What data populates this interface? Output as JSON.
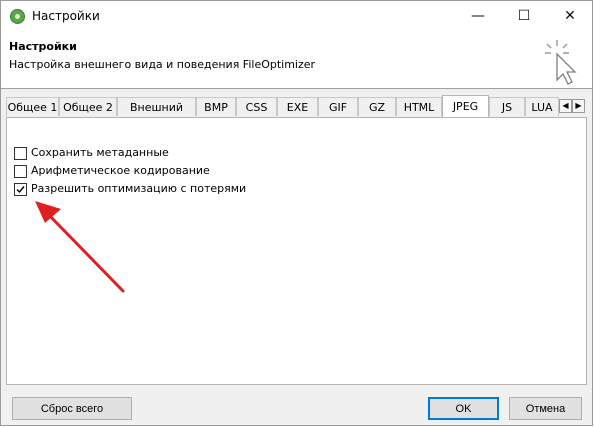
{
  "window": {
    "title": "Настройки",
    "minimize_glyph": "—",
    "maximize_glyph": "☐",
    "close_glyph": "✕"
  },
  "header": {
    "title": "Настройки",
    "subtitle": "Настройка внешнего вида и поведения FileOptimizer"
  },
  "tabs": [
    {
      "label": "Общее 1"
    },
    {
      "label": "Общее 2"
    },
    {
      "label": "Внешний вид"
    },
    {
      "label": "BMP"
    },
    {
      "label": "CSS"
    },
    {
      "label": "EXE"
    },
    {
      "label": "GIF"
    },
    {
      "label": "GZ"
    },
    {
      "label": "HTML"
    },
    {
      "label": "JPEG"
    },
    {
      "label": "JS"
    },
    {
      "label": "LUA"
    }
  ],
  "active_tab": "JPEG",
  "tab_scroll": {
    "left": "◀",
    "right": "▶"
  },
  "options": [
    {
      "label": "Сохранить метаданные",
      "checked": false
    },
    {
      "label": "Арифметическое кодирование",
      "checked": false
    },
    {
      "label": "Разрешить оптимизацию с потерями",
      "checked": true
    }
  ],
  "buttons": {
    "reset": "Сброс всего",
    "ok": "OK",
    "cancel": "Отмена"
  },
  "colors": {
    "accent": "#0078d7",
    "annotation_arrow": "#e02020",
    "app_icon": "#5aa64b"
  }
}
